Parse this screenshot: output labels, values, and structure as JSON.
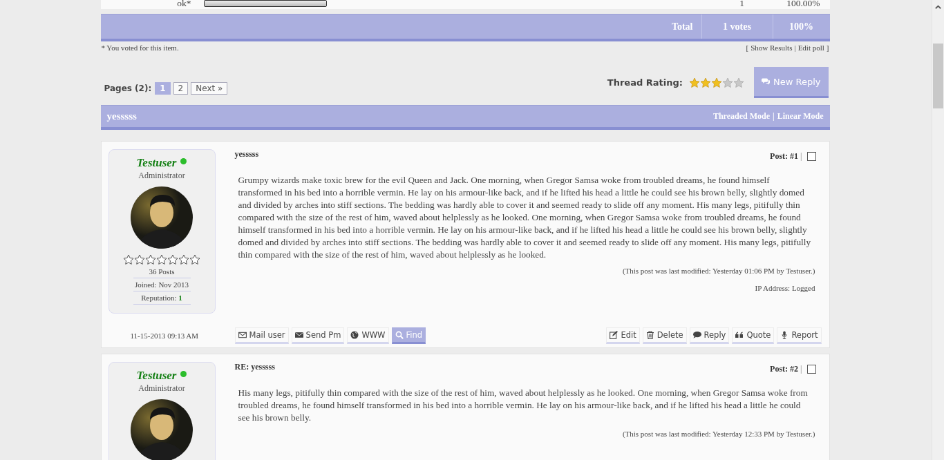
{
  "poll": {
    "option": {
      "label": "ok*",
      "level": 1,
      "votes": "1",
      "percent": "100.00%"
    },
    "total": {
      "label": "Total",
      "votes": "1 votes",
      "percent": "100%"
    },
    "note": "* You voted for this item.",
    "links": [
      {
        "label": "Show Results"
      },
      {
        "label": "Edit poll"
      }
    ],
    "open": "[",
    "sep": "|",
    "close": "]"
  },
  "pagination": {
    "label": "Pages (2):",
    "pages": [
      {
        "label": "1",
        "selected": true
      },
      {
        "label": "2",
        "selected": false
      }
    ],
    "next": "Next »"
  },
  "rating": {
    "label": "Thread Rating:",
    "stars": 3
  },
  "new_reply": "New Reply",
  "thread": {
    "title": "yesssss",
    "modes": [
      {
        "label": "Threaded Mode"
      },
      {
        "label": "Linear Mode"
      }
    ],
    "sep": "|"
  },
  "posts": [
    {
      "author": "Testuser",
      "online": true,
      "role": "Administrator",
      "stars": 0,
      "posts": "36 Posts",
      "joined": "Joined: Nov 2013",
      "reputation_label": "Reputation:",
      "reputation": "1",
      "date": "11-15-2013 09:13 AM",
      "subject": "yesssss",
      "post_label": "Post:",
      "number": "#1",
      "sep": "|",
      "selected": false,
      "body": "Grumpy wizards make toxic brew for the evil Queen and Jack. One morning, when Gregor Samsa woke from troubled dreams, he found himself transformed in his bed into a horrible vermin. He lay on his armour-like back, and if he lifted his head a little he could see his brown belly, slightly domed and divided by arches into stiff sections. The bedding was hardly able to cover it and seemed ready to slide off any moment. His many legs, pitifully thin compared with the size of the rest of him, waved about helplessly as he looked. One morning, when Gregor Samsa woke from troubled dreams, he found himself transformed in his bed into a horrible vermin. He lay on his armour-like back, and if he lifted his head a little he could see his brown belly, slightly domed and divided by arches into stiff sections. The bedding was hardly able to cover it and seemed ready to slide off any moment. His many legs, pitifully thin compared with the size of the rest of him, waved about helplessly as he looked.",
      "modified": "(This post was last modified: Yesterday 01:06 PM by Testuser.)",
      "ip": "IP Address: Logged",
      "left_buttons": [
        {
          "kind": "mail",
          "label": "Mail user",
          "highlighted": false
        },
        {
          "kind": "pm",
          "label": "Send Pm",
          "highlighted": false
        },
        {
          "kind": "www",
          "label": "WWW",
          "highlighted": false
        },
        {
          "kind": "find",
          "label": "Find",
          "highlighted": true
        }
      ],
      "right_buttons": [
        {
          "kind": "edit",
          "label": "Edit"
        },
        {
          "kind": "delete",
          "label": "Delete"
        },
        {
          "kind": "reply",
          "label": "Reply"
        },
        {
          "kind": "quote",
          "label": "Quote"
        },
        {
          "kind": "report",
          "label": "Report"
        }
      ]
    },
    {
      "author": "Testuser",
      "online": true,
      "role": "Administrator",
      "subject": "RE: yesssss",
      "post_label": "Post:",
      "number": "#2",
      "sep": "|",
      "selected": false,
      "body": "His many legs, pitifully thin compared with the size of the rest of him, waved about helplessly as he looked. One morning, when Gregor Samsa woke from troubled dreams, he found himself transformed in his bed into a horrible vermin. He lay on his armour-like back, and if he lifted his head a little he could see his brown belly.",
      "modified": "(This post was last modified: Yesterday 12:33 PM by Testuser.)"
    }
  ]
}
